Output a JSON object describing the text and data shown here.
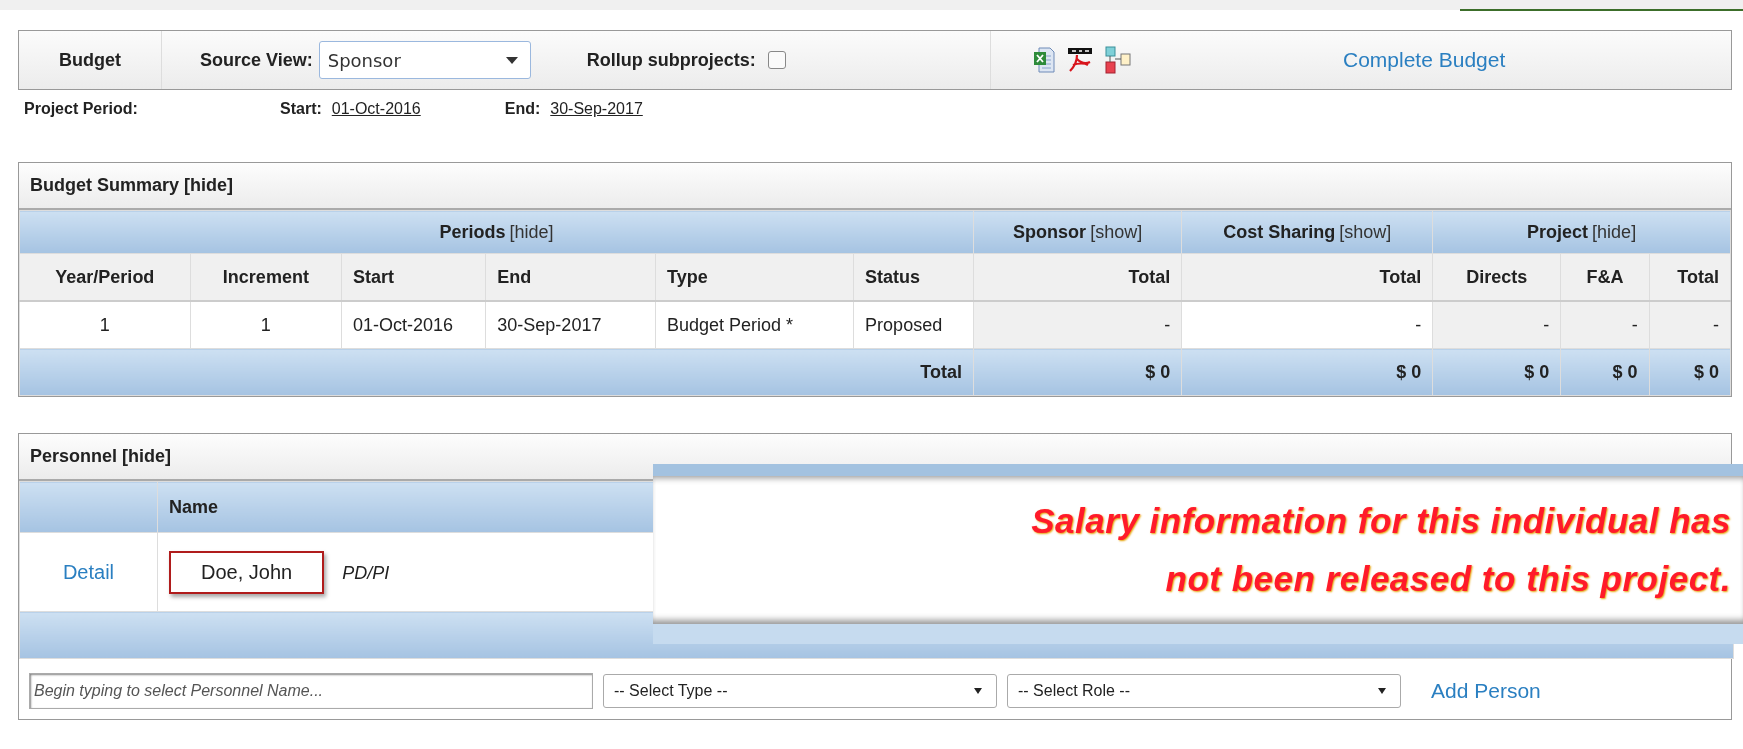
{
  "toolbar": {
    "title": "Budget",
    "source_view": {
      "label": "Source View:",
      "value": "Sponsor"
    },
    "rollup": {
      "label": "Rollup subprojects:",
      "checked": false
    },
    "link": "Complete Budget"
  },
  "project_period": {
    "label": "Project Period:",
    "start_label": "Start:",
    "start": "01-Oct-2016",
    "end_label": "End:",
    "end": "30-Sep-2017"
  },
  "budget_summary": {
    "title": "Budget Summary [hide]",
    "groups": [
      {
        "label": "Periods",
        "toggle": "[hide]",
        "columns": [
          "Year/Period",
          "Increment",
          "Start",
          "End",
          "Type",
          "Status"
        ]
      },
      {
        "label": "Sponsor",
        "toggle": "[show]",
        "columns": [
          "Total"
        ]
      },
      {
        "label": "Cost Sharing",
        "toggle": "[show]",
        "columns": [
          "Total"
        ]
      },
      {
        "label": "Project",
        "toggle": "[hide]",
        "columns": [
          "Directs",
          "F&A",
          "Total"
        ]
      }
    ],
    "rows": [
      {
        "cells": [
          "1",
          "1",
          "01-Oct-2016",
          "30-Sep-2017",
          "Budget Period *",
          "Proposed",
          "-",
          "-",
          "-",
          "-",
          "-"
        ]
      }
    ],
    "total_row": {
      "label": "Total",
      "values": [
        "$ 0",
        "$ 0",
        "$ 0",
        "$ 0",
        "$ 0"
      ]
    }
  },
  "personnel": {
    "title": "Personnel [hide]",
    "columns": [
      "Name"
    ],
    "rows": [
      {
        "link": "Detail",
        "name": "Doe, John",
        "role": "PD/PI"
      }
    ],
    "add_row": {
      "name_placeholder": "Begin typing to select Personnel Name...",
      "type_select": "-- Select Type --",
      "role_select": "-- Select Role --",
      "button": "Add Person"
    }
  },
  "notice": {
    "lines": [
      "Salary information for this individual has",
      "not been released to this project."
    ]
  }
}
